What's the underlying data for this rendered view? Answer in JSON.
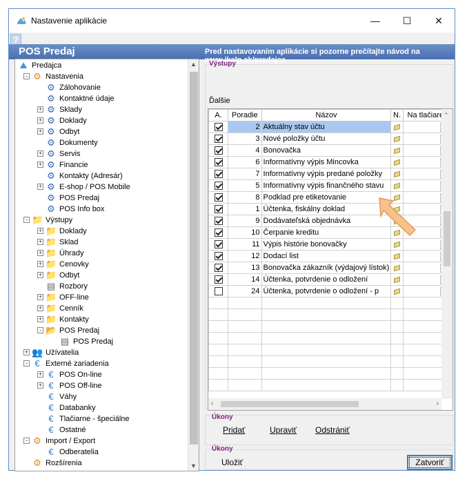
{
  "window": {
    "title": "Nastavenie aplikácie",
    "minimize": "—",
    "maximize": "☐",
    "close": "✕"
  },
  "banner": {
    "help": "?",
    "left": "POS Predaj",
    "right": "Pred nastavovaním aplikácie si pozorne prečítajte návod na www.ikelp.sk/predajca"
  },
  "tree": [
    {
      "label": "Predajca",
      "level": 0,
      "icon": "app-icon",
      "exp": ""
    },
    {
      "label": "Nastavenia",
      "level": 1,
      "icon": "gear-icon",
      "exp": "-"
    },
    {
      "label": "Zálohovanie",
      "level": 2,
      "icon": "cog-icon",
      "exp": ""
    },
    {
      "label": "Kontaktné údaje",
      "level": 2,
      "icon": "cog-icon",
      "exp": ""
    },
    {
      "label": "Sklady",
      "level": 2,
      "icon": "cog-icon",
      "exp": "+"
    },
    {
      "label": "Doklady",
      "level": 2,
      "icon": "cog-icon",
      "exp": "+"
    },
    {
      "label": "Odbyt",
      "level": 2,
      "icon": "cog-icon",
      "exp": "+"
    },
    {
      "label": "Dokumenty",
      "level": 2,
      "icon": "cog-icon",
      "exp": ""
    },
    {
      "label": "Servis",
      "level": 2,
      "icon": "cog-icon",
      "exp": "+"
    },
    {
      "label": "Financie",
      "level": 2,
      "icon": "cog-icon",
      "exp": "+"
    },
    {
      "label": "Kontakty (Adresár)",
      "level": 2,
      "icon": "cog-icon",
      "exp": ""
    },
    {
      "label": "E-shop / POS Mobile",
      "level": 2,
      "icon": "cog-icon",
      "exp": "+"
    },
    {
      "label": "POS Predaj",
      "level": 2,
      "icon": "cog-icon",
      "exp": ""
    },
    {
      "label": "POS Info box",
      "level": 2,
      "icon": "cog-icon",
      "exp": ""
    },
    {
      "label": "Výstupy",
      "level": 1,
      "icon": "folder-icon",
      "exp": "-"
    },
    {
      "label": "Doklady",
      "level": 2,
      "icon": "folder-icon",
      "exp": "+"
    },
    {
      "label": "Sklad",
      "level": 2,
      "icon": "folder-icon",
      "exp": "+"
    },
    {
      "label": "Úhrady",
      "level": 2,
      "icon": "folder-icon",
      "exp": "+"
    },
    {
      "label": "Cenovky",
      "level": 2,
      "icon": "folder-icon",
      "exp": "+"
    },
    {
      "label": "Odbyt",
      "level": 2,
      "icon": "folder-icon",
      "exp": "+"
    },
    {
      "label": "Rozbory",
      "level": 2,
      "icon": "document-icon",
      "exp": ""
    },
    {
      "label": "OFF-line",
      "level": 2,
      "icon": "folder-icon",
      "exp": "+"
    },
    {
      "label": "Cenník",
      "level": 2,
      "icon": "folder-icon",
      "exp": "+"
    },
    {
      "label": "Kontakty",
      "level": 2,
      "icon": "folder-icon",
      "exp": "+"
    },
    {
      "label": "POS Predaj",
      "level": 2,
      "icon": "folder-open-icon",
      "exp": "-"
    },
    {
      "label": "POS Predaj",
      "level": 3,
      "icon": "document-icon",
      "exp": ""
    },
    {
      "label": "Užívatelia",
      "level": 1,
      "icon": "users-icon",
      "exp": "+"
    },
    {
      "label": "Externé zariadenia",
      "level": 1,
      "icon": "device-icon",
      "exp": "-"
    },
    {
      "label": "POS On-line",
      "level": 2,
      "icon": "device-icon",
      "exp": "+"
    },
    {
      "label": "POS Off-line",
      "level": 2,
      "icon": "device-icon",
      "exp": "+"
    },
    {
      "label": "Váhy",
      "level": 2,
      "icon": "device-icon",
      "exp": ""
    },
    {
      "label": "Databanky",
      "level": 2,
      "icon": "device-icon",
      "exp": ""
    },
    {
      "label": "Tlačiarne - špeciálne",
      "level": 2,
      "icon": "device-icon",
      "exp": ""
    },
    {
      "label": "Ostatné",
      "level": 2,
      "icon": "device-icon",
      "exp": ""
    },
    {
      "label": "Import / Export",
      "level": 1,
      "icon": "gear-icon",
      "exp": "-"
    },
    {
      "label": "Odberatelia",
      "level": 2,
      "icon": "device-icon",
      "exp": ""
    },
    {
      "label": "Rozšírenia",
      "level": 1,
      "icon": "gear-icon",
      "exp": ""
    }
  ],
  "outputs_group": {
    "title": "Výstupy",
    "dalsie": "Ďalšie"
  },
  "grid": {
    "headers": [
      "A.",
      "Poradie",
      "Názov",
      "N.",
      "Na tlačiareň"
    ],
    "rows": [
      {
        "checked": true,
        "order": "2",
        "name": "Aktuálny stav účtu",
        "selected": true
      },
      {
        "checked": true,
        "order": "3",
        "name": "Nové položky účtu",
        "selected": false
      },
      {
        "checked": true,
        "order": "4",
        "name": "Bonovačka",
        "selected": false
      },
      {
        "checked": true,
        "order": "6",
        "name": "Informatívny výpis Mincovka",
        "selected": false
      },
      {
        "checked": true,
        "order": "7",
        "name": "Informatívny výpis predané položky",
        "selected": false
      },
      {
        "checked": true,
        "order": "5",
        "name": "Informatívny výpis finančného stavu",
        "selected": false
      },
      {
        "checked": true,
        "order": "8",
        "name": "Podklad pre etiketovanie",
        "selected": false
      },
      {
        "checked": true,
        "order": "1",
        "name": "Účtenka, fiskálny doklad",
        "selected": false
      },
      {
        "checked": true,
        "order": "9",
        "name": "Dodávateľská objednávka",
        "selected": false
      },
      {
        "checked": true,
        "order": "10",
        "name": "Čerpanie kreditu",
        "selected": false
      },
      {
        "checked": true,
        "order": "11",
        "name": "Výpis histórie bonovačky",
        "selected": false
      },
      {
        "checked": true,
        "order": "12",
        "name": "Dodací list",
        "selected": false
      },
      {
        "checked": true,
        "order": "13",
        "name": "Bonovačka zákazník (výdajový lístok)",
        "selected": false
      },
      {
        "checked": true,
        "order": "14",
        "name": "Účtenka, potvrdenie o odložení",
        "selected": false
      },
      {
        "checked": false,
        "order": "24",
        "name": "Účtenka, potvrdenie o odložení - p",
        "selected": false
      }
    ]
  },
  "actions_group": {
    "title": "Úkony",
    "add": "Pridať",
    "edit": "Upraviť",
    "remove": "Odstrániť"
  },
  "footer_group": {
    "title": "Úkony",
    "save": "Uložiť",
    "close": "Zatvoriť"
  },
  "colors": {
    "banner": "#5a7fbe",
    "group_title": "#7a1f7a",
    "selection": "#a9c8ef",
    "accent_arrow": "#f6b57a"
  }
}
